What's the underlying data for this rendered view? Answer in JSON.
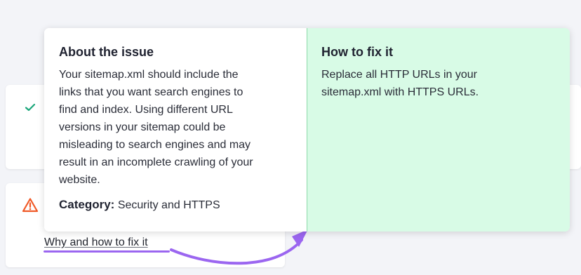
{
  "popup": {
    "about": {
      "title": "About the issue",
      "lines": [
        "Your sitemap.xml should include the",
        "links that you want search engines to",
        "find and index. Using different URL",
        "versions in your sitemap could be",
        "misleading to search engines and may",
        "result in an incomplete crawling of your",
        "website."
      ],
      "category_label": "Category:",
      "category_value": "Security and HTTPS"
    },
    "fix": {
      "title": "How to fix it",
      "lines": [
        "Replace all HTTP URLs in your",
        "sitemap.xml with HTTPS URLs."
      ]
    }
  },
  "issue": {
    "link_label": "Why and how to fix it"
  },
  "icons": {
    "check": "check-icon",
    "warning": "warning-icon"
  },
  "colors": {
    "check": "#1aa67a",
    "warning": "#f05a28",
    "highlight": "#9b66f0",
    "fix_pane": "#d8fbe6"
  }
}
